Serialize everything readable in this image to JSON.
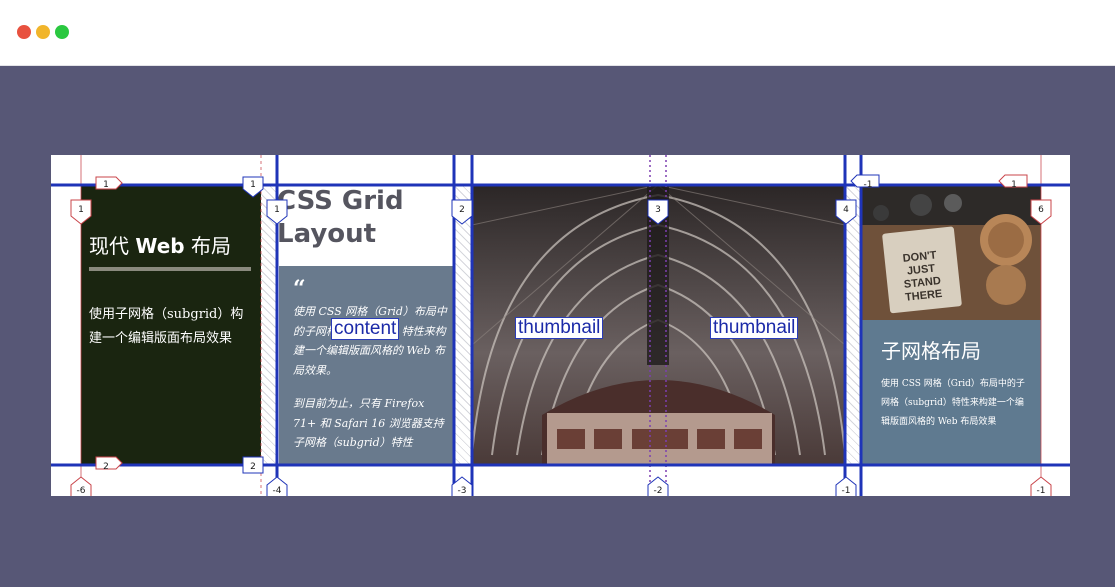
{
  "window": {
    "controls": [
      "close",
      "minimize",
      "maximize"
    ]
  },
  "colors": {
    "grid_line": "#1f34b8",
    "subgrid_line": "#c9444a",
    "card_dark": "#1a2510",
    "card_slate": "#697a8d",
    "card_blue": "#5f7a90"
  },
  "card1": {
    "heading_prefix": "现代 ",
    "heading_bold": "Web",
    "heading_suffix": " 布局",
    "body": "使用子网格（subgrid）构建一个编辑版面布局效果"
  },
  "card2": {
    "title": "CSS Grid Layout",
    "quote_mark": "“",
    "para1": "使用 CSS 网格（Grid）布局中的子网格（subgrid）特性来构建一个编辑版面风格的 Web 布局效果。",
    "para2": "到目前为止，只有 Firefox 71+ 和 Safari 16 浏览器支持子网格（subgrid）特性"
  },
  "card4": {
    "heading": "子网格布局",
    "body": "使用 CSS 网格（Grid）布局中的子网格（subgrid）特性来构建一个编辑版面风格的 Web 布局效果",
    "photo_sign_text": "DON'T JUST STAND THERE"
  },
  "area_labels": {
    "thumbnail_1": "thumbnail",
    "thumbnail_2": "thumbnail",
    "content": "content"
  },
  "line_numbers": {
    "col_top": [
      "1",
      "1",
      "1",
      "2",
      "3",
      "4",
      "-1",
      "1",
      "6"
    ],
    "row_top": [
      "1",
      "1",
      "1"
    ],
    "row_bottom": [
      "2",
      "2"
    ],
    "col_bottom": [
      "-6",
      "-4",
      "-3",
      "-2",
      "-1",
      "-1"
    ]
  }
}
